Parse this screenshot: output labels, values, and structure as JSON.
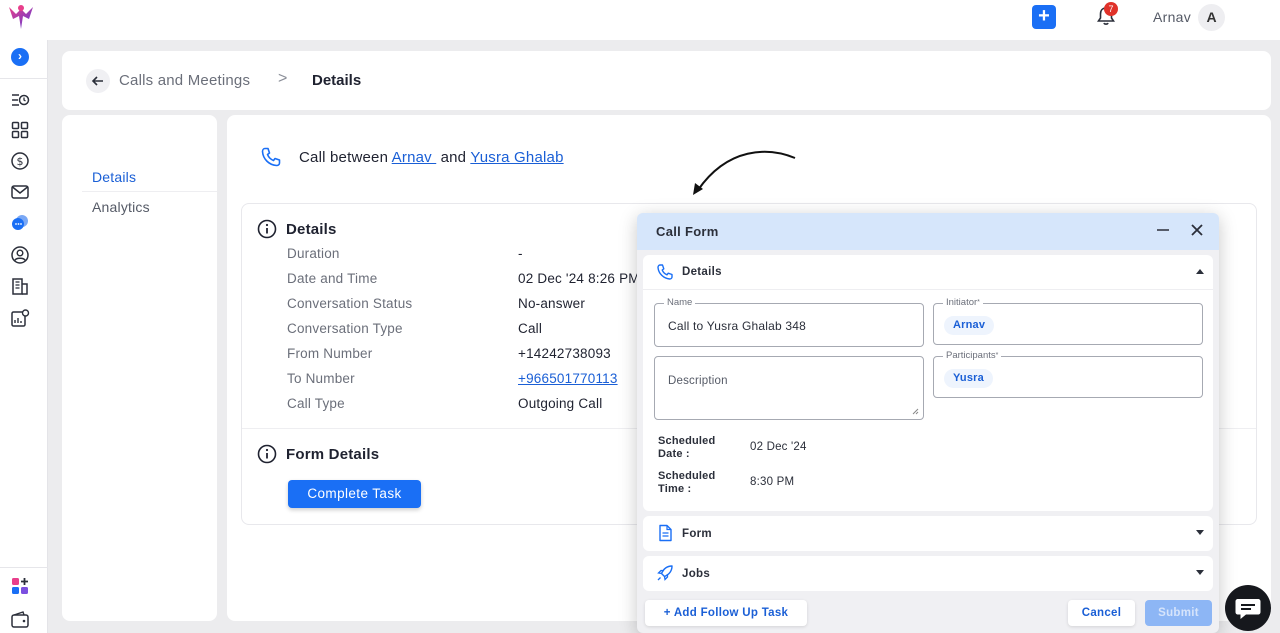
{
  "topbar": {
    "notification_count": "7",
    "user_name": "Arnav",
    "avatar_initial": "A",
    "plus_label": "+"
  },
  "sidebar": {
    "expand_icon": "chevron-right-icon",
    "items": [
      "list-clock-icon",
      "grid-icon",
      "dollar-icon",
      "mail-icon",
      "chat-icon",
      "user-circle-icon",
      "building-icon",
      "chart-gear-icon"
    ],
    "bottom_items": [
      "apps-add-icon",
      "wallet-icon"
    ]
  },
  "breadcrumb": {
    "parent": "Calls and Meetings",
    "separator": ">",
    "current": "Details"
  },
  "left_nav": {
    "items": [
      {
        "label": "Details",
        "active": true
      },
      {
        "label": "Analytics",
        "active": false
      }
    ]
  },
  "call": {
    "title_prefix": "Call between",
    "party_a": "Arnav ",
    "conjunction": " and ",
    "party_b": "Yusra Ghalab"
  },
  "details": {
    "title": "Details",
    "rows": [
      {
        "label": "Duration",
        "value": "-"
      },
      {
        "label": "Date and Time",
        "value": "02 Dec '24 8:26 PM"
      },
      {
        "label": "Conversation Status",
        "value": "No-answer"
      },
      {
        "label": "Conversation Type",
        "value": "Call"
      },
      {
        "label": "From Number",
        "value": "+14242738093"
      },
      {
        "label": "To Number",
        "value": "+966501770113"
      },
      {
        "label": "Call Type",
        "value": "Outgoing Call"
      }
    ]
  },
  "form_details": {
    "title": "Form Details",
    "complete_button": "Complete Task"
  },
  "call_form": {
    "title": "Call Form",
    "details_section": "Details",
    "name_label": "Name",
    "name_value": "Call to Yusra Ghalab 348",
    "initiator_label": "Initiator",
    "initiator_value": "Arnav",
    "description_placeholder": "Description",
    "participants_label": "Participants",
    "participants_value": "Yusra",
    "required_mark": "*",
    "scheduled_date_label_1": "Scheduled",
    "scheduled_date_label_2": "Date :",
    "scheduled_date_value": "02 Dec '24",
    "scheduled_time_label_1": "Scheduled",
    "scheduled_time_label_2": "Time :",
    "scheduled_time_value": "8:30 PM",
    "form_section": "Form",
    "jobs_section": "Jobs",
    "follow_up_button": "+ Add Follow Up Task",
    "cancel_button": "Cancel",
    "submit_button": "Submit"
  },
  "colors": {
    "primary": "#1a6ff5",
    "link": "#1a5fd6",
    "modal_header": "#d6e6fb",
    "badge": "#e0322a"
  }
}
